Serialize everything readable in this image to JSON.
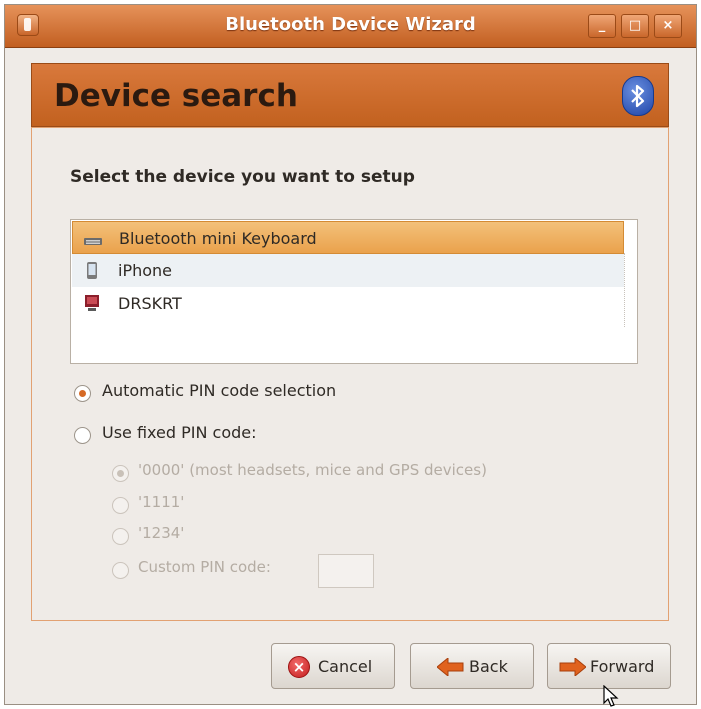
{
  "window": {
    "title": "Bluetooth Device Wizard",
    "controls": {
      "minimize": "_",
      "maximize": "□",
      "close": "×"
    }
  },
  "header": {
    "title": "Device search",
    "icon": "bluetooth-icon"
  },
  "main": {
    "prompt": "Select the device you want to setup",
    "devices": [
      {
        "name": "Bluetooth mini Keyboard",
        "icon": "keyboard-icon",
        "selected": true
      },
      {
        "name": "iPhone",
        "icon": "phone-icon",
        "selected": false
      },
      {
        "name": "DRSKRT",
        "icon": "computer-icon",
        "selected": false
      }
    ],
    "pin_options": {
      "automatic": {
        "label": "Automatic PIN code selection",
        "checked": true
      },
      "fixed": {
        "label": "Use fixed PIN code:",
        "checked": false
      },
      "fixed_choices": [
        {
          "label": "'0000' (most headsets, mice and GPS devices)",
          "checked": true,
          "enabled": false
        },
        {
          "label": "'1111'",
          "checked": false,
          "enabled": false
        },
        {
          "label": "'1234'",
          "checked": false,
          "enabled": false
        },
        {
          "label": "Custom PIN code:",
          "checked": false,
          "enabled": false
        }
      ],
      "custom_pin_value": ""
    }
  },
  "buttons": {
    "cancel": "Cancel",
    "back": "Back",
    "forward": "Forward"
  },
  "colors": {
    "accent": "#c9672b",
    "selection": "#eaa24c",
    "window_bg": "#efebe7"
  }
}
